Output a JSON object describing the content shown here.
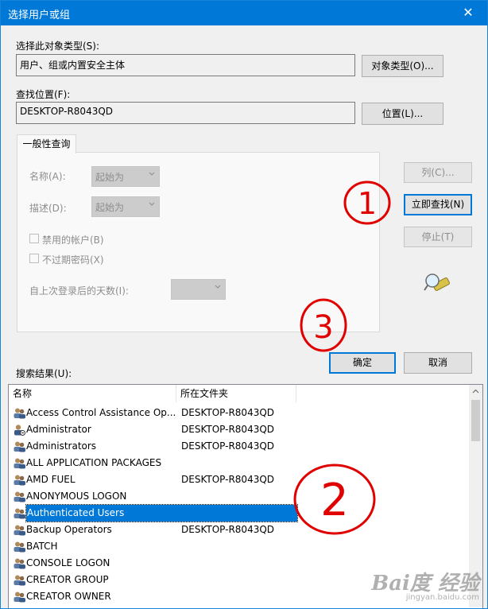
{
  "window": {
    "title": "选择用户或组",
    "close_glyph": "✕"
  },
  "object_type": {
    "label": "选择此对象类型(S):",
    "value": "用户、组或内置安全主体",
    "button": "对象类型(O)..."
  },
  "location": {
    "label": "查找位置(F):",
    "value": "DESKTOP-R8043QD",
    "button": "位置(L)..."
  },
  "query": {
    "tab": "一般性查询",
    "name_label": "名称(A):",
    "name_mode": "起始为",
    "desc_label": "描述(D):",
    "desc_mode": "起始为",
    "disabled_accounts": "禁用的帐户(B)",
    "non_expiring_pwd": "不过期密码(X)",
    "days_since_logon": "自上次登录后的天数(I):"
  },
  "buttons": {
    "columns": "列(C)...",
    "find_now": "立即查找(N)",
    "stop": "停止(T)",
    "ok": "确定",
    "cancel": "取消"
  },
  "results": {
    "label": "搜索结果(U):",
    "columns": [
      "名称",
      "所在文件夹"
    ],
    "rows": [
      {
        "name": "Access Control Assistance Op...",
        "folder": "DESKTOP-R8043QD",
        "icon": "group-icon"
      },
      {
        "name": "Administrator",
        "folder": "DESKTOP-R8043QD",
        "icon": "user-icon"
      },
      {
        "name": "Administrators",
        "folder": "DESKTOP-R8043QD",
        "icon": "group-icon"
      },
      {
        "name": "ALL APPLICATION PACKAGES",
        "folder": "",
        "icon": "group-icon"
      },
      {
        "name": "AMD FUEL",
        "folder": "DESKTOP-R8043QD",
        "icon": "group-icon"
      },
      {
        "name": "ANONYMOUS LOGON",
        "folder": "",
        "icon": "group-icon"
      },
      {
        "name": "Authenticated Users",
        "folder": "",
        "icon": "group-icon",
        "selected": true
      },
      {
        "name": "Backup Operators",
        "folder": "DESKTOP-R8043QD",
        "icon": "group-icon"
      },
      {
        "name": "BATCH",
        "folder": "",
        "icon": "group-icon"
      },
      {
        "name": "CONSOLE LOGON",
        "folder": "",
        "icon": "group-icon"
      },
      {
        "name": "CREATOR GROUP",
        "folder": "",
        "icon": "group-icon"
      },
      {
        "name": "CREATOR OWNER",
        "folder": "",
        "icon": "group-icon"
      }
    ]
  },
  "annotations": {
    "one": "1",
    "two": "2",
    "three": "3"
  },
  "watermark": {
    "brand": "Bai度 经验",
    "url": "jingyan.baidu.com"
  },
  "colors": {
    "accent": "#0078d7",
    "annotation": "#e00000"
  }
}
